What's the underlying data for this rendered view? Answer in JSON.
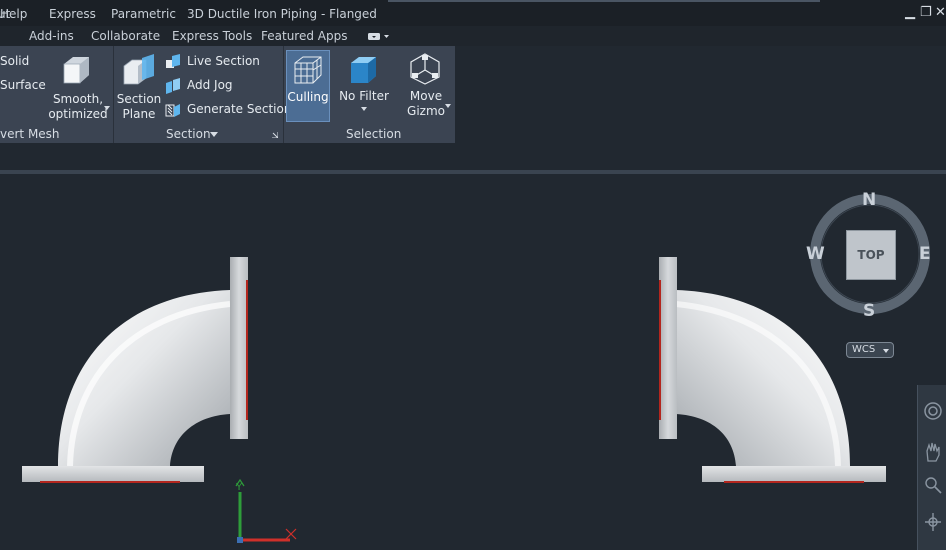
{
  "menu": {
    "items": [
      "ut",
      "Help",
      "Express",
      "Parametric"
    ],
    "document_title": "3D Ductile Iron Piping - Flanged"
  },
  "ribbon_tabs": [
    "Add-ins",
    "Collaborate",
    "Express Tools",
    "Featured Apps"
  ],
  "ribbon": {
    "mesh": {
      "solid_label": "Solid",
      "surface_label": "Surface",
      "smooth_label_1": "Smooth,",
      "smooth_label_2": "optimized",
      "panel_title": "vert Mesh"
    },
    "section": {
      "plane_label_1": "Section",
      "plane_label_2": "Plane",
      "live_section": "Live Section",
      "add_jog": "Add Jog",
      "generate_section": "Generate Section",
      "panel_title": "Section"
    },
    "selection": {
      "culling": "Culling",
      "no_filter": "No Filter",
      "move_label_1": "Move",
      "move_label_2": "Gizmo",
      "panel_title": "Selection"
    }
  },
  "viewcube": {
    "north": "N",
    "south": "S",
    "east": "E",
    "west": "W",
    "face": "TOP",
    "wcs": "WCS"
  },
  "colors": {
    "background": "#212830",
    "ribbon": "#3b4452",
    "accent": "#4c6d94"
  }
}
